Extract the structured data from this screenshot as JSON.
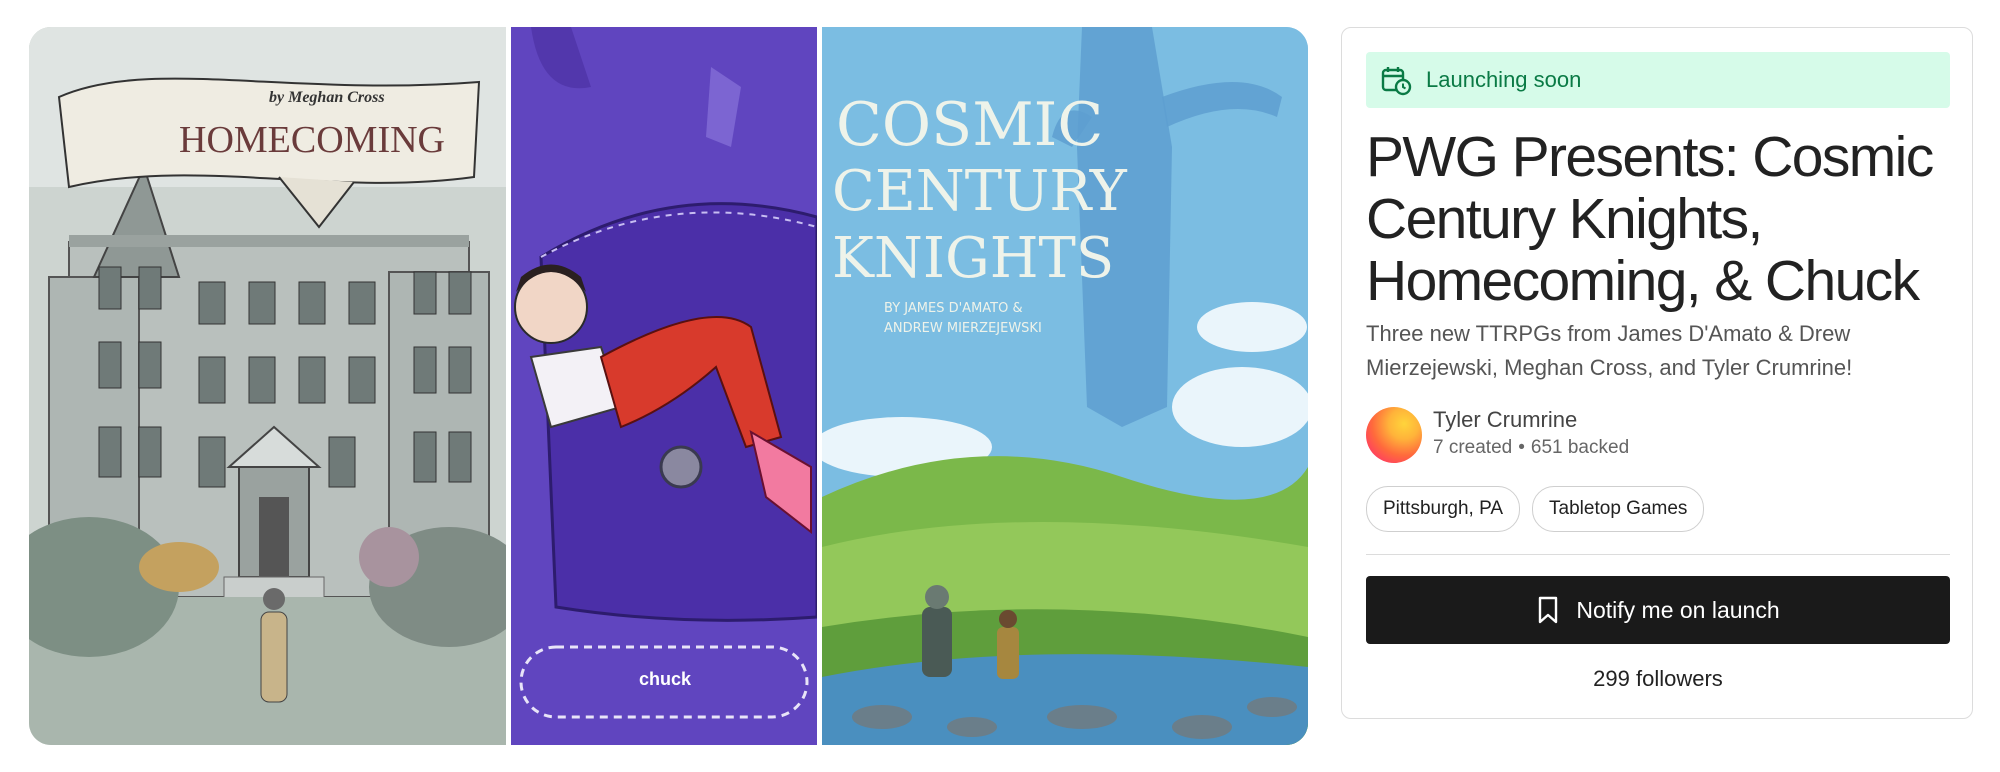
{
  "hero": {
    "panels": [
      {
        "name": "homecoming",
        "title": "HOMECOMING",
        "byline": "by Meghan Cross"
      },
      {
        "name": "chuck",
        "title": "chuck"
      },
      {
        "name": "cosmic-century-knights",
        "title_lines": [
          "COSMIC",
          "CENTURY",
          "KNIGHTS"
        ],
        "credits": [
          "BY JAMES D'AMATO &",
          "ANDREW MIERZEJEWSKI"
        ]
      }
    ]
  },
  "card": {
    "status": {
      "label": "Launching soon",
      "icon": "calendar-clock-icon",
      "bg": "#d6fbe9",
      "color": "#0a7a45"
    },
    "title": "PWG Presents: Cosmic Century Knights, Homecoming, & Chuck",
    "subtitle": "Three new TTRPGs from James D'Amato & Drew Mierzejewski, Meghan Cross, and Tyler Crumrine!",
    "creator": {
      "name": "Tyler Crumrine",
      "created": "7 created",
      "separator": "•",
      "backed": "651 backed"
    },
    "tags": [
      "Pittsburgh, PA",
      "Tabletop Games"
    ],
    "notify_button": {
      "label": "Notify me on launch",
      "icon": "bookmark-icon"
    },
    "followers": "299 followers"
  }
}
